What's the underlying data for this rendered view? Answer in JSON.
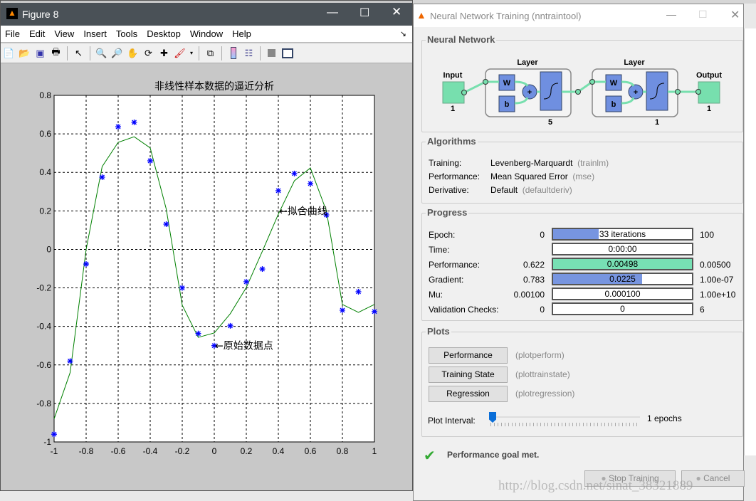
{
  "figure": {
    "title": "Figure 8",
    "menu": [
      "File",
      "Edit",
      "View",
      "Insert",
      "Tools",
      "Desktop",
      "Window",
      "Help"
    ],
    "toolbar_icons": [
      "new-file-icon",
      "open-folder-icon",
      "save-icon",
      "print-icon",
      "pointer-icon",
      "zoom-in-icon",
      "zoom-out-icon",
      "pan-hand-icon",
      "rotate-3d-icon",
      "data-cursor-icon",
      "brush-icon",
      "link-plot-icon",
      "colorbar-icon",
      "legend-icon",
      "hide-plot-tools-icon",
      "show-plot-tools-icon"
    ]
  },
  "chart_data": {
    "type": "line",
    "title": "非线性样本数据的逼近分析",
    "xlim": [
      -1,
      1
    ],
    "ylim": [
      -1,
      0.8
    ],
    "xticks": [
      "-1",
      "-0.8",
      "-0.6",
      "-0.4",
      "-0.2",
      "0",
      "0.2",
      "0.4",
      "0.6",
      "0.8",
      "1"
    ],
    "yticks": [
      "0.8",
      "0.6",
      "0.4",
      "0.2",
      "0",
      "-0.2",
      "-0.4",
      "-0.6",
      "-0.8",
      "-1"
    ],
    "grid": true,
    "x": [
      -1,
      -0.9,
      -0.8,
      -0.7,
      -0.6,
      -0.5,
      -0.4,
      -0.3,
      -0.2,
      -0.1,
      0,
      0.1,
      0.2,
      0.3,
      0.4,
      0.5,
      0.6,
      0.7,
      0.8,
      0.9,
      1
    ],
    "series": [
      {
        "style": "scatter",
        "marker": "*",
        "color": "#0000ff",
        "values": [
          -0.96,
          -0.58,
          -0.076,
          0.375,
          0.637,
          0.66,
          0.46,
          0.131,
          -0.2,
          -0.437,
          -0.5,
          -0.397,
          -0.168,
          -0.102,
          0.305,
          0.394,
          0.342,
          0.179,
          -0.316,
          -0.22,
          -0.323
        ]
      },
      {
        "style": "line",
        "color": "#008000",
        "values": [
          -0.88,
          -0.64,
          0.0,
          0.43,
          0.556,
          0.585,
          0.527,
          0.21,
          -0.29,
          -0.457,
          -0.434,
          -0.334,
          -0.198,
          -0.01,
          0.183,
          0.356,
          0.423,
          0.2,
          -0.286,
          -0.327,
          -0.286
        ]
      }
    ],
    "annotations": [
      {
        "text": "←拟合曲线",
        "x": 0.4,
        "y": 0.2
      },
      {
        "text": "←原始数据点",
        "x": 0,
        "y": -0.5
      }
    ]
  },
  "nntool": {
    "title": "Neural Network Training (nntraintool)",
    "network": {
      "label": "Neural Network",
      "input": "Input",
      "input_size": "1",
      "layer": "Layer",
      "layer1_size": "5",
      "layer2_size": "1",
      "output": "Output",
      "output_size": "1",
      "w": "W",
      "b": "b",
      "plus": "+"
    },
    "algorithms": {
      "label": "Algorithms",
      "rows": [
        {
          "name": "Training:",
          "value": "Levenberg-Marquardt",
          "fn": "(trainlm)"
        },
        {
          "name": "Performance:",
          "value": "Mean Squared Error",
          "fn": "(mse)"
        },
        {
          "name": "Derivative:",
          "value": "Default",
          "fn": "(defaultderiv)"
        }
      ]
    },
    "progress": {
      "label": "Progress",
      "rows": [
        {
          "name": "Epoch:",
          "start": "0",
          "value": "33 iterations",
          "end": "100",
          "fill": 0.33,
          "color": "#7795e0"
        },
        {
          "name": "Time:",
          "start": "",
          "value": "0:00:00",
          "end": "",
          "fill": 0,
          "color": "#7795e0"
        },
        {
          "name": "Performance:",
          "start": "0.622",
          "value": "0.00498",
          "end": "0.00500",
          "fill": 1.0,
          "color": "#77e0b4"
        },
        {
          "name": "Gradient:",
          "start": "0.783",
          "value": "0.0225",
          "end": "1.00e-07",
          "fill": 0.64,
          "color": "#7795e0"
        },
        {
          "name": "Mu:",
          "start": "0.00100",
          "value": "0.000100",
          "end": "1.00e+10",
          "fill": 0,
          "color": "#7795e0"
        },
        {
          "name": "Validation Checks:",
          "start": "0",
          "value": "0",
          "end": "6",
          "fill": 0,
          "color": "#7795e0"
        }
      ]
    },
    "plots": {
      "label": "Plots",
      "buttons": [
        {
          "label": "Performance",
          "fn": "(plotperform)"
        },
        {
          "label": "Training State",
          "fn": "(plottrainstate)"
        },
        {
          "label": "Regression",
          "fn": "(plotregression)"
        }
      ],
      "interval_label": "Plot Interval:",
      "interval_value": "1 epochs",
      "slider_fraction": 0
    },
    "status": "Performance goal met.",
    "stop_label": "Stop Training",
    "cancel_label": "Cancel"
  },
  "watermark": "http://blog.csdn.net/sinat_38321889"
}
